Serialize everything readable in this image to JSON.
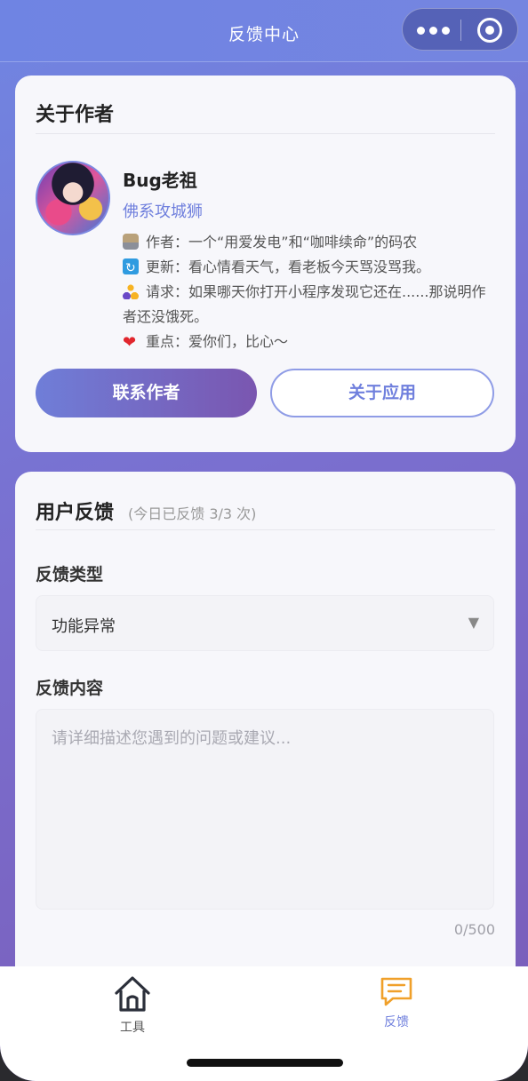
{
  "nav": {
    "title": "反馈中心"
  },
  "about": {
    "title": "关于作者",
    "name": "Bug老祖",
    "role": "佛系攻城狮",
    "lines": [
      {
        "icon": "worker-icon",
        "text": "作者：一个“用爱发电”和“咖啡续命”的码农"
      },
      {
        "icon": "refresh-icon",
        "text": "更新：看心情看天气，看老板今天骂没骂我。"
      },
      {
        "icon": "people-icon",
        "text": "请求：如果哪天你打开小程序发现它还在......那说明作者还没饿死。"
      },
      {
        "icon": "heart-icon",
        "text": "重点：爱你们，比心～"
      }
    ],
    "contact_button": "联系作者",
    "about_app_button": "关于应用"
  },
  "feedback": {
    "title": "用户反馈",
    "subtitle": "(今日已反馈 3/3 次)",
    "type_label": "反馈类型",
    "type_value": "功能异常",
    "content_label": "反馈内容",
    "content_placeholder": "请详细描述您遇到的问题或建议...",
    "counter": "0/500"
  },
  "tabbar": {
    "items": [
      {
        "label": "工具",
        "icon": "home-icon",
        "active": false
      },
      {
        "label": "反馈",
        "icon": "chat-icon",
        "active": true
      }
    ]
  },
  "colors": {
    "accent": "#6f7fdd",
    "gradient_start": "#6f7ed8",
    "gradient_end": "#7a56b0",
    "tab_active": "#f0a02a"
  }
}
